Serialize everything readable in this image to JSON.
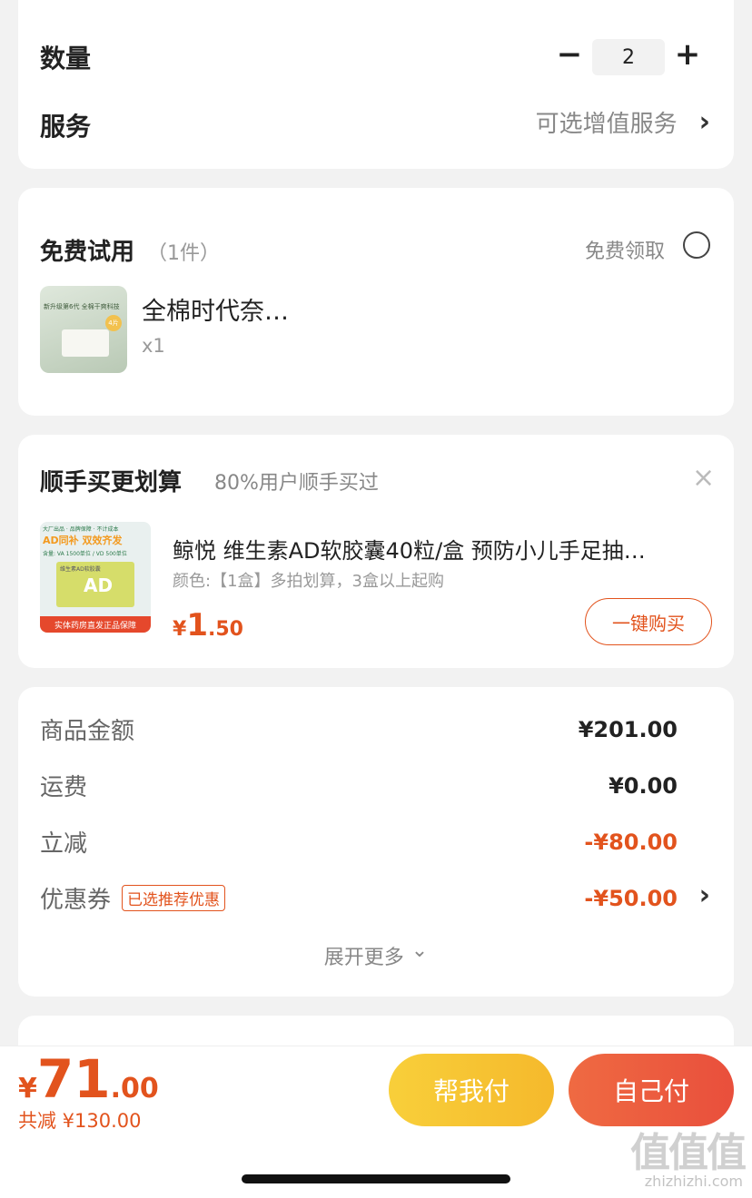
{
  "spec": {
    "quantity_label": "数量",
    "quantity_value": "2",
    "minus": "−",
    "plus": "+",
    "service_label": "服务",
    "service_value": "可选增值服务",
    "chevron": "›"
  },
  "trial": {
    "title": "免费试用",
    "count": "（1件）",
    "claim_label": "免费领取",
    "product_name": "全棉时代奈…",
    "product_qty": "x1",
    "thumb_text": "新升级第6代 全棉干爽科技",
    "thumb_badge": "4片"
  },
  "addon": {
    "title": "顺手买更划算",
    "subtitle": "80%用户顺手买过",
    "close": "×",
    "product_name": "鲸悦 维生素AD软胶囊40粒/盒 预防小儿手足抽…",
    "variant": "颜色:【1盒】多拍划算，3盒以上起购",
    "price_symbol": "¥",
    "price_int": "1",
    "price_dec": ".50",
    "buy_button": "一键购买",
    "thumb_top": "大厂出品 · 品牌保障 · 不计成本",
    "thumb_headline": "AD同补 双效齐发",
    "thumb_sub": "含量: VA 1500单位 / VD 500单位",
    "thumb_box": "维生素AD软胶囊",
    "thumb_big": "AD",
    "thumb_footer": "实体药房直发正品保障"
  },
  "summary": {
    "goods_label": "商品金额",
    "goods_value": "¥201.00",
    "shipping_label": "运费",
    "shipping_value": "¥0.00",
    "discount_label": "立减",
    "discount_value": "-¥80.00",
    "coupon_label": "优惠券",
    "coupon_tag": "已选推荐优惠",
    "coupon_value": "-¥50.00",
    "expand": "展开更多",
    "expand_icon": "⌄"
  },
  "footer": {
    "price_symbol": "¥",
    "price_int": "71",
    "price_dec": ".00",
    "saved": "共减 ¥130.00",
    "help_pay": "帮我付",
    "self_pay": "自己付"
  },
  "watermark": {
    "text": "值值值",
    "url": "zhizhizhi.com"
  },
  "colors": {
    "accent": "#e2531d",
    "help_pay_bg": "#f7c531",
    "self_pay_bg": "#ec5b3c"
  }
}
